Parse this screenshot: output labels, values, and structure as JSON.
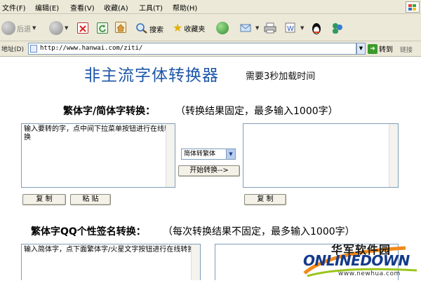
{
  "menu": {
    "items": [
      "文件(F)",
      "编辑(E)",
      "查看(V)",
      "收藏(A)",
      "工具(T)",
      "帮助(H)"
    ]
  },
  "toolbar": {
    "back_label": "后退",
    "search_label": "搜索",
    "favorites_label": "收藏夹"
  },
  "address": {
    "label": "地址(D)",
    "url": "http://www.hanwai.com/ziti/",
    "go_label": "转到",
    "links_label": "链接"
  },
  "page": {
    "title": "非主流字体转换器",
    "load_note": "需要3秒加载时间"
  },
  "section1": {
    "heading": "繁体字/简体字转换：",
    "note": "（转换结果固定，最多输入1000字）",
    "input_text": "输入要转的字，点中间下拉菜单按钮进行在线转换",
    "output_text": "",
    "mode_selected": "简体转繁体",
    "convert_label": "开始转换-->",
    "copy_label": "复 制",
    "paste_label": "粘 贴",
    "copy2_label": "复 制"
  },
  "section2": {
    "heading": "繁体字QQ个性签名转换：",
    "note": "（每次转换结果不固定，最多输入1000字）",
    "input_text": "输入简体字，点下面繁体字/火星文字按钮进行在线转换"
  },
  "watermark": {
    "cn": "华军软件园",
    "logo": "ONLINEDOWN",
    "url": "www.newhua.com"
  },
  "colors": {
    "chrome": "#ece9d8",
    "title": "#1e56a8",
    "field_border": "#7f9db9",
    "watermark_blue": "#143a8c"
  }
}
